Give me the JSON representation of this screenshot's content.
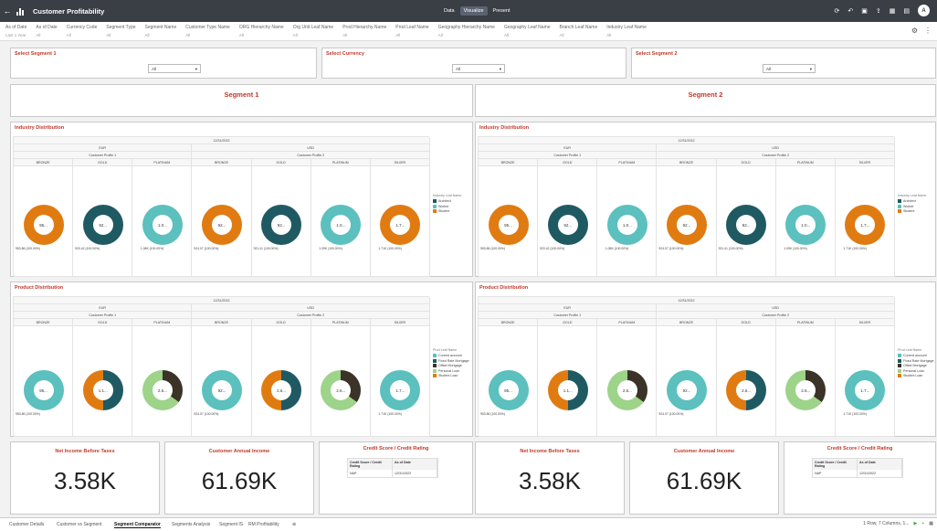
{
  "app": {
    "title": "Customer Profitability",
    "modes": [
      "Data",
      "Visualize",
      "Present"
    ],
    "active_mode": "Visualize",
    "avatar": "A"
  },
  "toolbar_icons": [
    "refresh-icon",
    "undo-icon",
    "redo-icon",
    "save-icon",
    "share-icon",
    "menu-icon"
  ],
  "filters": [
    {
      "label": "As of Date",
      "value": "Last 1 Year"
    },
    {
      "label": "As of Date",
      "value": "All"
    },
    {
      "label": "Currency Code",
      "value": "All"
    },
    {
      "label": "Segment Type",
      "value": "All"
    },
    {
      "label": "Segment Name",
      "value": "All"
    },
    {
      "label": "Customer Type Name",
      "value": "All"
    },
    {
      "label": "ORG Hierarchy Name",
      "value": "All"
    },
    {
      "label": "Org Unit Leaf Name",
      "value": "All"
    },
    {
      "label": "Prod Hierarchy Name",
      "value": "All"
    },
    {
      "label": "Prod Leaf Name",
      "value": "All"
    },
    {
      "label": "Geography Hierarchy Name",
      "value": "All"
    },
    {
      "label": "Geography Leaf Name",
      "value": "All"
    },
    {
      "label": "Branch Leaf Name",
      "value": "All"
    },
    {
      "label": "Industry Leaf Name",
      "value": "All"
    }
  ],
  "selectors": [
    {
      "title": "Select Segment 1",
      "value": "All"
    },
    {
      "title": "Select Currency",
      "value": "All"
    },
    {
      "title": "Select Segment 2",
      "value": "All"
    }
  ],
  "segments": [
    {
      "title": "Segment 1",
      "industry_title": "Industry Distribution",
      "product_title": "Product Distribution",
      "date": "12/31/2022",
      "currencies": [
        "EUR",
        "USD"
      ],
      "profiles": [
        "Customer Profile 1",
        "Customer Profile 2"
      ],
      "tiers": [
        "BRONZE",
        "GOLD",
        "PLATINUM",
        "BRONZE",
        "GOLD",
        "PLATINUM",
        "SILVER"
      ],
      "industry_values": [
        "953.86 (100.00%)",
        "920.42 (100.00%)",
        "1.08K (100.00%)",
        "924.07 (100.00%)",
        "921.41 (100.00%)",
        "1.09K (100.00%)",
        "1.71K (100.00%)"
      ],
      "industry_centers": [
        "95...",
        "92...",
        "1.0...",
        "92...",
        "92...",
        "1.0...",
        "1.7..."
      ],
      "product_values": [
        "953.86 (100.00%)",
        "",
        "",
        "924.07 (100.00%)",
        "",
        "",
        "1.71K (100.00%)"
      ],
      "product_centers": [
        "95...",
        "1.1...",
        "2.6...",
        "92...",
        "2.6...",
        "2.6...",
        "1.7..."
      ],
      "kpis": {
        "net_income_label": "Net Income Before Taxes",
        "net_income_value": "3.58K",
        "annual_income_label": "Customer Annual Income",
        "annual_income_value": "61.69K",
        "credit_title": "Credit Score / Credit Rating",
        "credit_headers": [
          "Credit Score / Credit Rating",
          "As of Date"
        ],
        "credit_row": [
          "NAP",
          "12/31/2022"
        ]
      }
    },
    {
      "title": "Segment 2",
      "industry_title": "Industry Distribution",
      "product_title": "Product Distribution",
      "date": "12/31/2022",
      "currencies": [
        "EUR",
        "USD"
      ],
      "profiles": [
        "Customer Profile 1",
        "Customer Profile 2"
      ],
      "tiers": [
        "BRONZE",
        "GOLD",
        "PLATINUM",
        "BRONZE",
        "GOLD",
        "PLATINUM",
        "SILVER"
      ],
      "industry_values": [
        "953.86 (100.00%)",
        "920.42 (100.00%)",
        "1.08K (100.00%)",
        "924.07 (100.00%)",
        "921.41 (100.00%)",
        "1.09K (100.00%)",
        "1.71K (100.00%)"
      ],
      "industry_centers": [
        "95...",
        "92...",
        "1.0...",
        "92...",
        "92...",
        "1.0...",
        "1.7..."
      ],
      "product_values": [
        "953.86 (100.00%)",
        "",
        "",
        "924.07 (100.00%)",
        "",
        "",
        "1.71K (100.00%)"
      ],
      "product_centers": [
        "95...",
        "1.1...",
        "2.6...",
        "92...",
        "2.6...",
        "2.6...",
        "1.7..."
      ],
      "kpis": {
        "net_income_label": "Net Income Before Taxes",
        "net_income_value": "3.58K",
        "annual_income_label": "Customer Annual Income",
        "annual_income_value": "61.69K",
        "credit_title": "Credit Score / Credit Rating",
        "credit_headers": [
          "Credit Score / Credit Rating",
          "As of Date"
        ],
        "credit_row": [
          "NAP",
          "12/31/2022"
        ]
      }
    }
  ],
  "industry_legend": {
    "title": "Industry Leaf Name",
    "items": [
      {
        "label": "Architect",
        "color": "#1f5a63"
      },
      {
        "label": "Worker",
        "color": "#5bc0be"
      },
      {
        "label": "Student",
        "color": "#e07b12"
      }
    ]
  },
  "industry_colors": [
    "#e07b12",
    "#1f5a63",
    "#5bc0be",
    "#e07b12",
    "#1f5a63",
    "#5bc0be",
    "#e07b12"
  ],
  "product_legend": {
    "title": "Prod Leaf Name",
    "items": [
      {
        "label": "Current account",
        "color": "#5bc0be"
      },
      {
        "label": "Fixed Rate Mortgage",
        "color": "#1f5a63"
      },
      {
        "label": "Offset Mortgage",
        "color": "#3b3228"
      },
      {
        "label": "Personal Loan",
        "color": "#9ed38a"
      },
      {
        "label": "Student Loan",
        "color": "#e07b12"
      }
    ]
  },
  "product_pies": [
    {
      "type": "full",
      "colors": [
        "#5bc0be"
      ],
      "fractions": [
        1
      ]
    },
    {
      "type": "split",
      "colors": [
        "#1f5a63",
        "#e07b12"
      ],
      "fractions": [
        0.5,
        0.5
      ]
    },
    {
      "type": "split",
      "colors": [
        "#3b3228",
        "#9ed38a"
      ],
      "fractions": [
        0.35,
        0.65
      ]
    },
    {
      "type": "full",
      "colors": [
        "#5bc0be"
      ],
      "fractions": [
        1
      ]
    },
    {
      "type": "split",
      "colors": [
        "#1f5a63",
        "#e07b12"
      ],
      "fractions": [
        0.5,
        0.5
      ]
    },
    {
      "type": "split",
      "colors": [
        "#3b3228",
        "#9ed38a"
      ],
      "fractions": [
        0.35,
        0.65
      ]
    },
    {
      "type": "full",
      "colors": [
        "#5bc0be"
      ],
      "fractions": [
        1
      ]
    }
  ],
  "tabs": [
    "Customer Details",
    "Customer vs Segment",
    "Segment Comparator",
    "Segments Analysis",
    "Segment IS",
    "RM Profitability"
  ],
  "active_tab": "Segment Comparator",
  "status": "1 Row, 7 Columns, 1..."
}
